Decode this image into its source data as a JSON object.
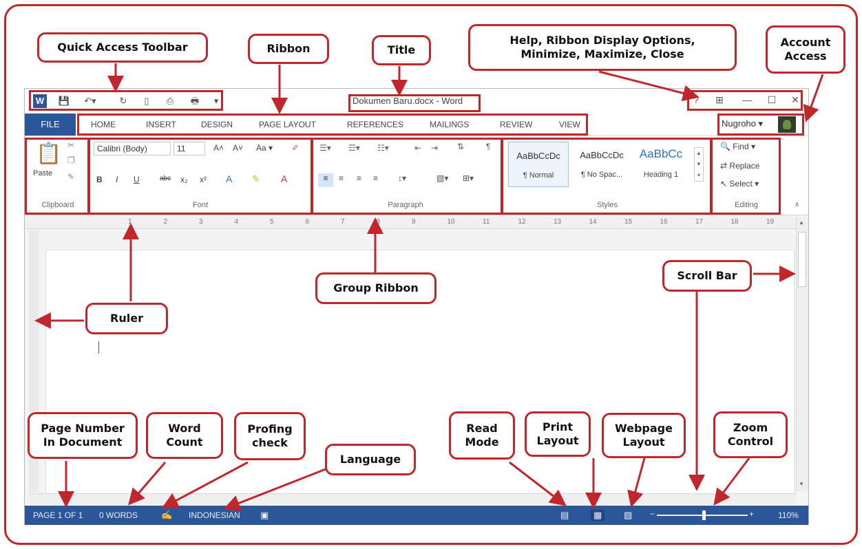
{
  "word": {
    "title": "Dokumen Baru.docx - Word",
    "file_tab": "FILE",
    "tabs": [
      {
        "label": "HOME"
      },
      {
        "label": "INSERT"
      },
      {
        "label": "DESIGN"
      },
      {
        "label": "PAGE LAYOUT"
      },
      {
        "label": "REFERENCES"
      },
      {
        "label": "MAILINGS"
      },
      {
        "label": "REVIEW"
      },
      {
        "label": "VIEW"
      }
    ],
    "account_name": "Nugroho",
    "window_controls": {
      "help": "?",
      "minimize": "—",
      "maximize": "☐",
      "close": "✕"
    },
    "ribbon": {
      "clipboard": {
        "paste": "Paste",
        "label": "Clipboard"
      },
      "font": {
        "name": "Calibri (Body)",
        "size": "11",
        "label": "Font",
        "change_case": "Aa"
      },
      "paragraph": {
        "label": "Paragraph"
      },
      "styles": {
        "label": "Styles",
        "items": [
          {
            "sample": "AaBbCcDc",
            "name": "¶ Normal"
          },
          {
            "sample": "AaBbCcDc",
            "name": "¶ No Spac..."
          },
          {
            "sample": "AaBbCc",
            "name": "Heading 1"
          }
        ]
      },
      "editing": {
        "find": "Find",
        "replace": "Replace",
        "select": "Select",
        "label": "Editing"
      }
    },
    "ruler_numbers": [
      "1",
      "2",
      "3",
      "4",
      "5",
      "6",
      "7",
      "8",
      "9",
      "10",
      "11",
      "12",
      "13",
      "14",
      "15",
      "16",
      "17",
      "18",
      "19"
    ],
    "status": {
      "page": "PAGE 1 OF 1",
      "words": "0 WORDS",
      "language": "INDONESIAN",
      "zoom": "110%"
    }
  },
  "callouts": {
    "quick_access": "Quick Access Toolbar",
    "ribbon": "Ribbon",
    "title": "Title",
    "help_options": "Help, Ribbon Display Options,\nMinimize, Maximize, Close",
    "account": "Account\nAccess",
    "group_ribbon": "Group Ribbon",
    "ruler": "Ruler",
    "scroll_bar": "Scroll Bar",
    "page_number": "Page Number\nIn Document",
    "word_count": "Word\nCount",
    "proofing": "Profing\ncheck",
    "language": "Language",
    "read_mode": "Read\nMode",
    "print_layout": "Print\nLayout",
    "webpage_layout": "Webpage\nLayout",
    "zoom_control": "Zoom\nControl"
  },
  "colors": {
    "annotation": "#c0272d",
    "word_blue": "#2b579a"
  },
  "icons": [
    "word-logo-icon",
    "save-icon",
    "undo-icon",
    "redo-icon",
    "new-document-icon",
    "print-icon",
    "print-preview-icon",
    "help-icon",
    "ribbon-display-icon",
    "minimize-icon",
    "maximize-icon",
    "close-icon",
    "paste-icon",
    "find-icon",
    "replace-icon",
    "select-icon",
    "proofing-icon",
    "read-mode-icon",
    "print-layout-icon",
    "web-layout-icon"
  ]
}
